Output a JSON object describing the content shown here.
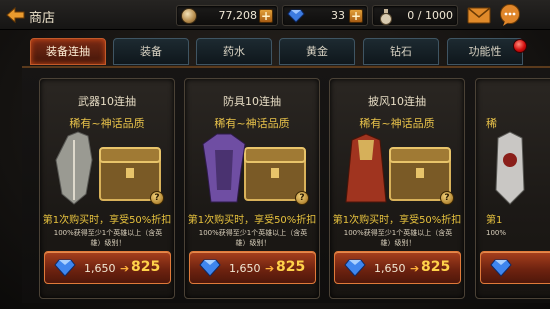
{
  "header": {
    "title": "商店",
    "coins": "77,208",
    "diamonds": "33",
    "stamina": "0 / 1000",
    "plus_label": "+"
  },
  "tabs": [
    {
      "label": "装备连抽",
      "active": true
    },
    {
      "label": "装备",
      "active": false
    },
    {
      "label": "药水",
      "active": false
    },
    {
      "label": "黄金",
      "active": false
    },
    {
      "label": "钻石",
      "active": false
    },
    {
      "label": "功能性",
      "active": false
    }
  ],
  "cards": [
    {
      "title": "武器10连抽",
      "quality": "稀有~神话品质",
      "discount": "第1次购买时，享受50%折扣",
      "note": "100%获得至少1个英雄以上（含英雄）级别！",
      "old_price": "1,650",
      "new_price": "825",
      "item_color": "#9a9a92"
    },
    {
      "title": "防具10连抽",
      "quality": "稀有~神话品质",
      "discount": "第1次购买时，享受50%折扣",
      "note": "100%获得至少1个英雄以上（含英雄）级别！",
      "old_price": "1,650",
      "new_price": "825",
      "item_color": "#6f4ea3"
    },
    {
      "title": "披风10连抽",
      "quality": "稀有~神话品质",
      "discount": "第1次购买时，享受50%折扣",
      "note": "100%获得至少1个英雄以上（含英雄）级别！",
      "old_price": "1,650",
      "new_price": "825",
      "item_color": "#a0341f"
    },
    {
      "title": "",
      "quality": "稀",
      "discount": "第1",
      "note": "100%",
      "old_price": "",
      "new_price": "",
      "item_color": "#c9c7c4"
    }
  ],
  "price_arrow": "➔",
  "info_symbol": "?",
  "colors": {
    "accent_orange": "#e07a3a",
    "gold_text": "#e7c23e",
    "tab_active": "#7a2a14"
  }
}
